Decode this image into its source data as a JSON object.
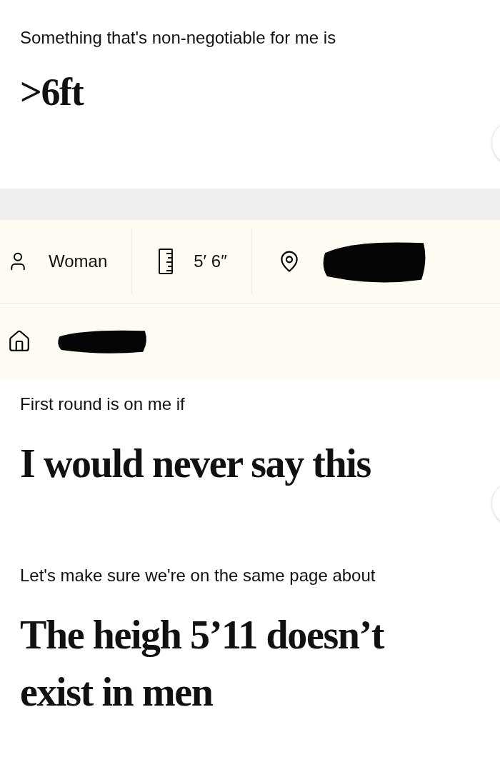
{
  "sections": [
    {
      "kind": "prompt",
      "question": "Something that's non-negotiable for me is",
      "answer": ">6ft",
      "like_button": true
    },
    {
      "kind": "gap"
    },
    {
      "kind": "info",
      "details": [
        {
          "kind": "gender",
          "text": "Woman"
        },
        {
          "kind": "height",
          "text": "5′ 6″"
        },
        {
          "kind": "location",
          "redacted": true
        }
      ],
      "hometown": {
        "redacted": true
      }
    },
    {
      "kind": "prompt",
      "question": "First round is on me if",
      "answer": "I would never say this",
      "like_button": true
    },
    {
      "kind": "prompt",
      "question": "Let's make sure we're on the same page about",
      "answer": "The heigh 5’11 doesn’t exist in men",
      "like_button": false
    }
  ]
}
